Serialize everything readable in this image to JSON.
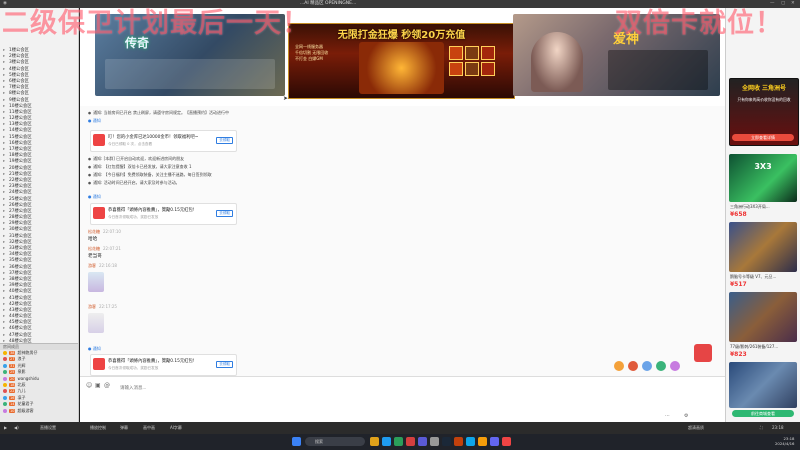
{
  "overlay": {
    "left_text": "二级保卫计划最后一天！",
    "right_text": "双倍卡就位！"
  },
  "top_bar": {
    "title": "...AI 精品区 OPENINGNE..."
  },
  "left_sidebar": {
    "rooms": [
      "1楼公会区",
      "2楼公会区",
      "3楼公会区",
      "4楼公会区",
      "5楼公会区",
      "6楼公会区",
      "7楼公会区",
      "8楼公会区",
      "9楼公会区",
      "10楼公会区",
      "11楼公会区",
      "12楼公会区",
      "13楼公会区",
      "14楼公会区",
      "15楼公会区",
      "16楼公会区",
      "17楼公会区",
      "18楼公会区",
      "19楼公会区",
      "20楼公会区",
      "21楼公会区",
      "22楼公会区",
      "23楼公会区",
      "24楼公会区",
      "25楼公会区",
      "26楼公会区",
      "27楼公会区",
      "28楼公会区",
      "29楼公会区",
      "30楼公会区",
      "31楼公会区",
      "32楼公会区",
      "33楼公会区",
      "34楼公会区",
      "35楼公会区",
      "36楼公会区",
      "37楼公会区",
      "38楼公会区",
      "39楼公会区",
      "40楼公会区",
      "41楼公会区",
      "42楼公会区",
      "43楼公会区",
      "44楼公会区",
      "45楼公会区",
      "46楼公会区",
      "47楼公会区",
      "48楼公会区",
      "49楼公会区",
      "50楼公会区",
      "51楼公会区",
      "52楼公会区"
    ],
    "section_label": "房间成员",
    "users": [
      {
        "name": "超神跑男仔",
        "level": "38"
      },
      {
        "name": "浪子",
        "level": "27"
      },
      {
        "name": "光辉",
        "level": "31"
      },
      {
        "name": "泉影",
        "level": "25"
      },
      {
        "name": "wangshidu",
        "level": "20"
      },
      {
        "name": "北辰",
        "level": "18"
      },
      {
        "name": "九儿",
        "level": "22"
      },
      {
        "name": "凛子",
        "level": "16"
      },
      {
        "name": "花童君子",
        "level": "14"
      },
      {
        "name": "超级游客",
        "level": "10"
      }
    ]
  },
  "banners": {
    "center_title": "无限打金狂爆 秒领20万充值",
    "center_line1": "全网一线服务器",
    "center_line2": "千倍切割 无限回收",
    "center_line3": "不打金 白嫖GM"
  },
  "chat": {
    "system_lines": [
      "通知: 当前房间已开启 禁止刷屏，请遵守房间规定。【直播预约】活动进行中",
      "通知: [本群] 已开启自动欢迎，欢迎新进房间的朋友",
      "通知: 【红包提醒】双倍卡已经发放，请大家注意查收 1",
      "通知: 【今日福利】免费领取装备，关注主播不迷路，每日签到领取",
      "通知: 活动时间已经开启，请大家及时参与活动。"
    ],
    "cards": [
      {
        "title": "叮！您的小金库已达10000金币！领取福利吧~",
        "sub": "今日已领取 0 次，点击查看",
        "button": "去领取"
      },
      {
        "title": "恭喜獲得「頭條內容推薦」，獎勵0.15元紅包!",
        "sub": "今日首次领取成功，奖励已发放",
        "button": "去领取"
      },
      {
        "title": "恭喜獲得「頭條內容推薦」，獎勵0.15元紅包!",
        "sub": "今日首次领取成功，奖励已发放",
        "button": "去领取"
      }
    ],
    "messages": [
      {
        "name": "松花糖",
        "time": "22:07:10",
        "text": "哈哈"
      },
      {
        "name": "松花糖",
        "time": "22:07:21",
        "text": "老当哥"
      },
      {
        "name": "游客",
        "time": "22:16:18",
        "text": ""
      },
      {
        "name": "游客",
        "time": "22:17:25",
        "text": ""
      }
    ],
    "input_placeholder": "请输入消息..."
  },
  "right_sidebar": {
    "promo_top": "全网收 三角洲号",
    "promo_top_sub": "只有你来的高价收你没有的回收",
    "products": [
      {
        "title": "三角洲行动3X3开局...",
        "price": "¥658"
      },
      {
        "title": "鹅脑号卡等级 V7、元旦...",
        "price": "¥517"
      },
      {
        "title": "77级/影刺/261装备/127...",
        "price": "¥823"
      }
    ],
    "bottom_button": "前往商城查看",
    "promo_button": "立即查看详情"
  },
  "player_bar": {
    "items": [
      "直播设置",
      "播放控制",
      "弹幕",
      "画中画",
      "AI字幕"
    ],
    "quality": "超清画质",
    "time": "23:18"
  },
  "taskbar": {
    "search_placeholder": "搜索",
    "clock": "23:18",
    "date": "2024/4/16"
  }
}
